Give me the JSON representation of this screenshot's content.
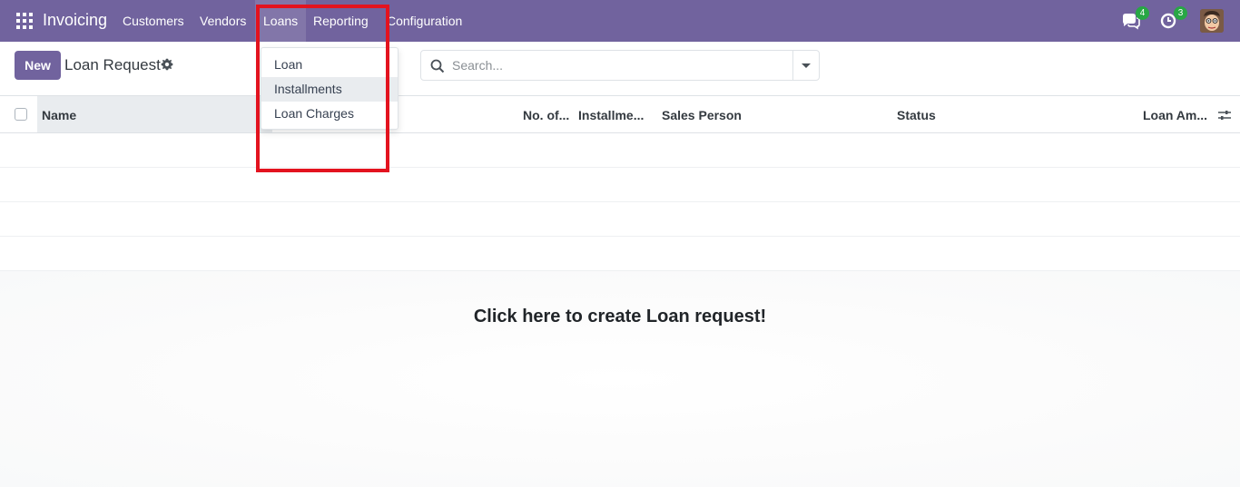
{
  "colors": {
    "brand": "#71639e",
    "badge": "#28a745",
    "highlight": "#e3131f"
  },
  "navbar": {
    "app_name": "Invoicing",
    "menu": [
      "Customers",
      "Vendors",
      "Loans",
      "Reporting",
      "Configuration"
    ],
    "active_menu": "Loans",
    "messages_count": "4",
    "activities_count": "3"
  },
  "control_panel": {
    "new_label": "New",
    "title": "Loan Request",
    "search_placeholder": "Search..."
  },
  "dropdown": {
    "items": [
      "Loan",
      "Installments",
      "Loan Charges"
    ],
    "hovered": "Installments"
  },
  "list": {
    "columns": [
      "Name",
      "No. of...",
      "Installme...",
      "Sales Person",
      "Status",
      "Loan Am..."
    ]
  },
  "empty_helper": "Click here to create Loan request!"
}
